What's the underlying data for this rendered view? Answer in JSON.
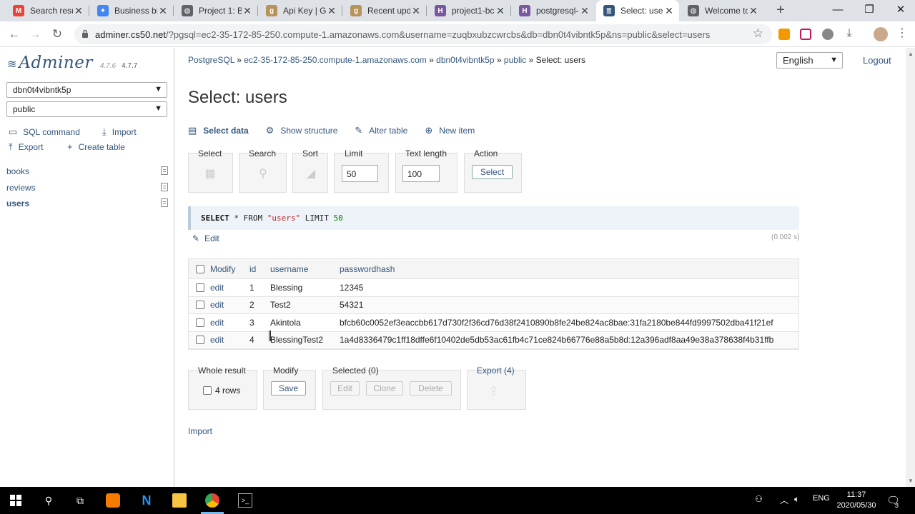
{
  "browser": {
    "tabs": [
      {
        "title": "Search resu",
        "icon": "gmail-icon",
        "color": "#ea4335",
        "glyph": "M"
      },
      {
        "title": "Business br",
        "icon": "settings-gear-icon",
        "color": "#4285f4",
        "glyph": "✦"
      },
      {
        "title": "Project 1: B",
        "icon": "globe-icon",
        "color": "#5f6368",
        "glyph": "◍"
      },
      {
        "title": "Api Key | Gc",
        "icon": "goodreads-icon",
        "color": "#b5935a",
        "glyph": "g"
      },
      {
        "title": "Recent upd",
        "icon": "goodreads-icon",
        "color": "#b5935a",
        "glyph": "g"
      },
      {
        "title": "project1-bc",
        "icon": "heroku-icon",
        "color": "#79589f",
        "glyph": "H"
      },
      {
        "title": "postgresql-",
        "icon": "heroku-icon",
        "color": "#79589f",
        "glyph": "H"
      },
      {
        "title": "Select: user",
        "icon": "adminer-db-icon",
        "color": "#34567c",
        "glyph": "≣"
      },
      {
        "title": "Welcome tc",
        "icon": "globe-icon",
        "color": "#5f6368",
        "glyph": "◍"
      }
    ],
    "active_tab": 7,
    "url_host": "adminer.cs50.net",
    "url_rest": "/?pgsql=ec2-35-172-85-250.compute-1.amazonaws.com&username=zuqbxubzcwrcbs&db=dbn0t4vibntk5p&ns=public&select=users"
  },
  "sidebar": {
    "logo": "Adminer",
    "version_old": "4.7.6",
    "version_new": "4.7.7",
    "db_select": "dbn0t4vibntk5p",
    "schema_select": "public",
    "links": {
      "sql_command": "SQL command",
      "import": "Import",
      "export": "Export",
      "create_table": "Create table"
    },
    "tables": [
      "books",
      "reviews",
      "users"
    ],
    "current_table": "users"
  },
  "header": {
    "crumbs": {
      "driver": "PostgreSQL",
      "server": "ec2-35-172-85-250.compute-1.amazonaws.com",
      "db": "dbn0t4vibntk5p",
      "schema": "public",
      "current": "Select: users",
      "sep": "»"
    },
    "language": "English",
    "logout": "Logout"
  },
  "page_title": "Select: users",
  "actions": {
    "select_data": "Select data",
    "show_structure": "Show structure",
    "alter_table": "Alter table",
    "new_item": "New item"
  },
  "form": {
    "select_label": "Select",
    "search_label": "Search",
    "sort_label": "Sort",
    "limit_label": "Limit",
    "limit_value": "50",
    "text_length_label": "Text length",
    "text_length_value": "100",
    "action_label": "Action",
    "action_button": "Select"
  },
  "query": {
    "select_kw": "SELECT",
    "star": "*",
    "from_kw": "FROM",
    "table": "\"users\"",
    "limit_kw": "LIMIT",
    "limit": "50",
    "edit": "Edit",
    "timing": "(0.002 s)"
  },
  "grid": {
    "columns": {
      "modify": "Modify",
      "id": "id",
      "username": "username",
      "passwordhash": "passwordhash"
    },
    "rows": [
      {
        "edit": "edit",
        "id": "1",
        "username": "Blessing",
        "passwordhash": "12345"
      },
      {
        "edit": "edit",
        "id": "2",
        "username": "Test2",
        "passwordhash": "54321"
      },
      {
        "edit": "edit",
        "id": "3",
        "username": "Akintola",
        "passwordhash": "bfcb60c0052ef3eaccbb617d730f2f36cd76d38f2410890b8fe24be824ac8bae:31fa2180be844fd9997502dba41f21ef"
      },
      {
        "edit": "edit",
        "id": "4",
        "username": "BlessingTest2",
        "passwordhash": "1a4d8336479c1ff18dffe6f10402de5db53ac61fb4c71ce824b66776e88a5b8d:12a396adf8aa49e38a378638f4b31ffb"
      }
    ]
  },
  "footer": {
    "whole_result": "Whole result",
    "rows_count": "4 rows",
    "modify": "Modify",
    "save": "Save",
    "selected": "Selected (0)",
    "edit": "Edit",
    "clone": "Clone",
    "delete": "Delete",
    "export": "Export (4)",
    "import": "Import"
  },
  "taskbar": {
    "time": "11:37",
    "date": "2020/05/30",
    "lang": "ENG",
    "notifications": "3"
  }
}
